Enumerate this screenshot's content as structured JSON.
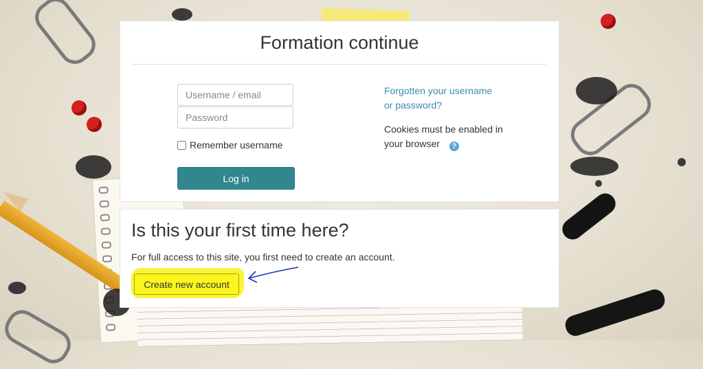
{
  "login": {
    "title": "Formation continue",
    "username_placeholder": "Username / email",
    "password_placeholder": "Password",
    "remember_label": "Remember username",
    "login_button": "Log in",
    "forgot_link": "Forgotten your username or password?",
    "cookies_text": "Cookies must be enabled in your browser",
    "help_icon": "question-circle-icon"
  },
  "signup": {
    "title": "Is this your first time here?",
    "description": "For full access to this site, you first need to create an account.",
    "create_button": "Create new account"
  },
  "colors": {
    "login_button": "#32878f",
    "link": "#3b8bb0",
    "highlight": "#f7f53a",
    "annotation_arrow": "#1a2fc9"
  }
}
